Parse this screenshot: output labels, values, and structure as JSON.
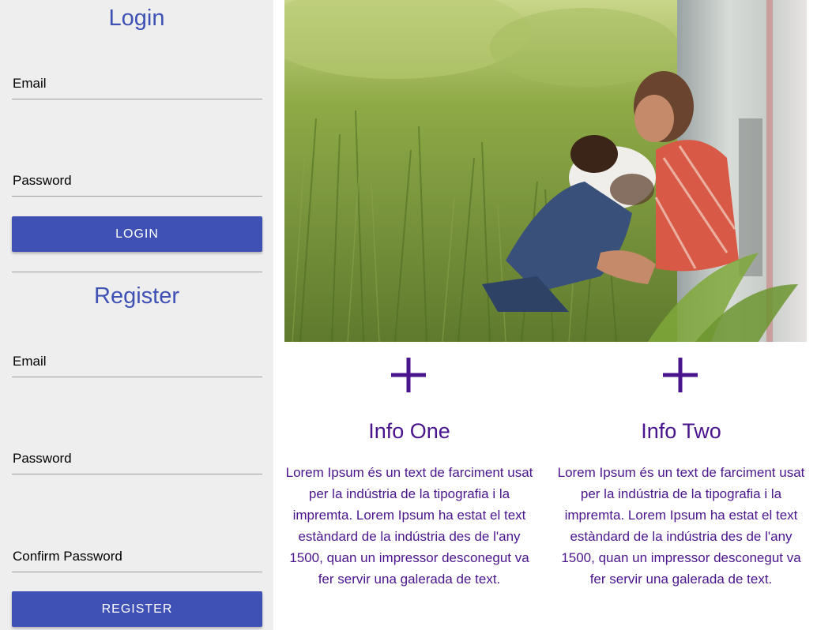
{
  "login": {
    "title": "Login",
    "email_label": "Email",
    "password_label": "Password",
    "button_label": "Login"
  },
  "register": {
    "title": "Register",
    "email_label": "Email",
    "password_label": "Password",
    "confirm_password_label": "Confirm Password",
    "button_label": "Register"
  },
  "colors": {
    "accent": "#3f51b5",
    "info_text": "#4a148c",
    "sidebar_bg": "#eeeeee"
  },
  "info": [
    {
      "icon": "plus-icon",
      "title": "Info One",
      "text": "Lorem Ipsum és un text de farciment usat per la indústria de la tipografia i la impremta. Lorem Ipsum ha estat el text estàndard de la indústria des de l'any 1500, quan un impressor desconegut va fer servir una galerada de text."
    },
    {
      "icon": "plus-icon",
      "title": "Info Two",
      "text": "Lorem Ipsum és un text de farciment usat per la indústria de la tipografia i la impremta. Lorem Ipsum ha estat el text estàndard de la indústria des de l'any 1500, quan un impressor desconegut va fer servir una galerada de text."
    }
  ]
}
